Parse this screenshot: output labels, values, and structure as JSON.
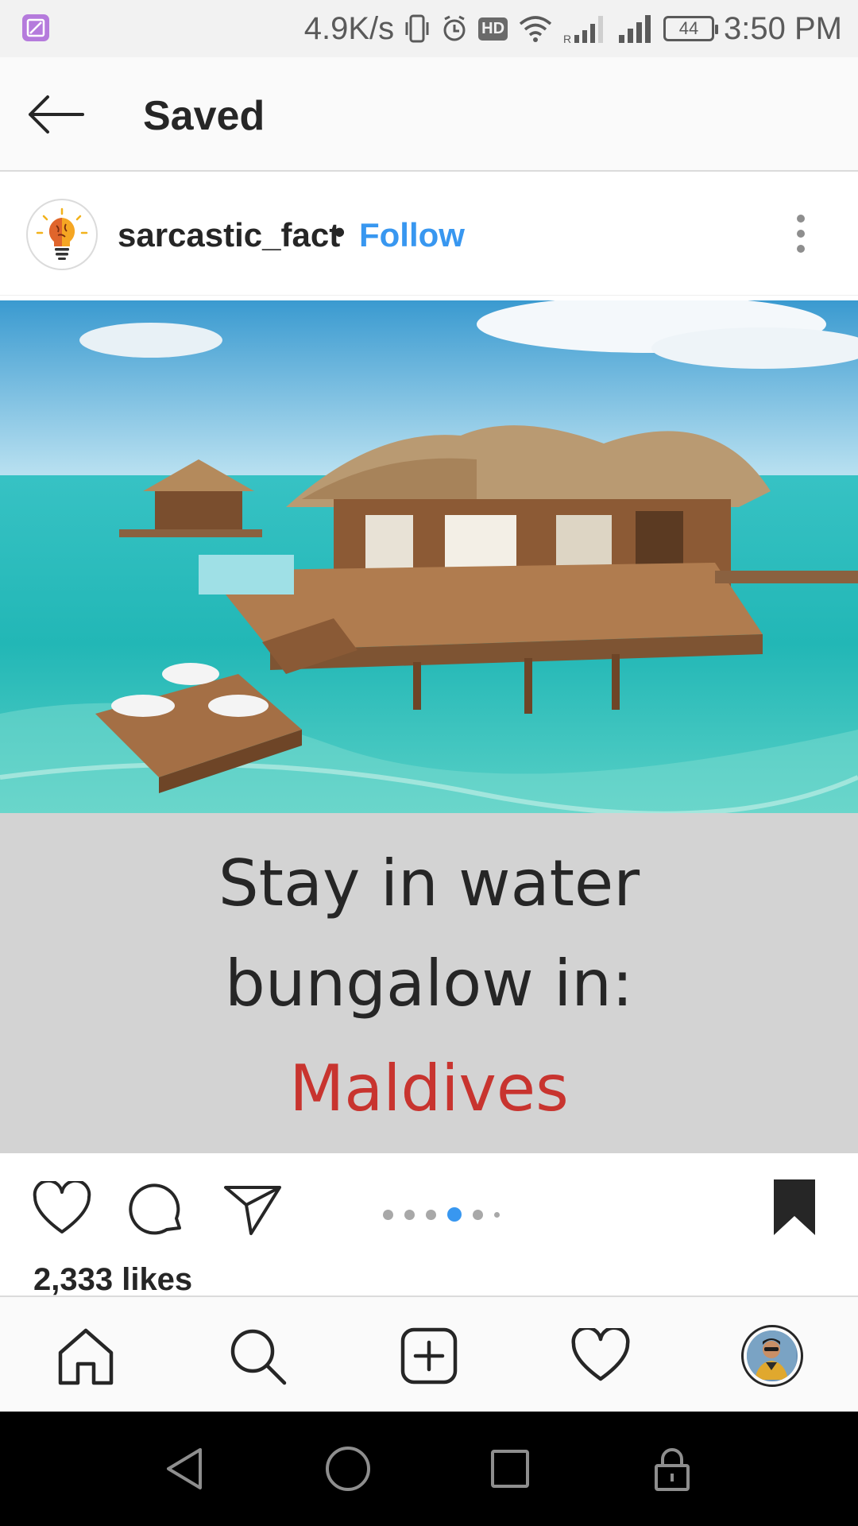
{
  "status_bar": {
    "network_speed": "4.9K/s",
    "hd_label": "HD",
    "battery_level": "44",
    "time": "3:50 PM",
    "icons": [
      "image-notification-icon",
      "vibrate-icon",
      "alarm-icon",
      "hd-icon",
      "wifi-icon",
      "signal-r-icon",
      "signal-icon",
      "battery-icon"
    ]
  },
  "top_bar": {
    "title": "Saved",
    "back_icon": "arrow-left-icon"
  },
  "post": {
    "username": "sarcastic_fact",
    "separator": "•",
    "follow_label": "Follow",
    "follow_color": "#3897f0",
    "avatar_icon": "lightbulb-brain-icon",
    "image_caption": {
      "line1": "Stay in water",
      "line2": "bungalow in:",
      "line3": "Maldives",
      "highlight_color": "#c8342f"
    },
    "carousel": {
      "total": 6,
      "active_index": 3
    },
    "likes": "2,333 likes",
    "saved": true
  },
  "bottom_nav": {
    "items": [
      "home-icon",
      "search-icon",
      "add-icon",
      "activity-heart-icon",
      "profile-avatar"
    ]
  },
  "system_nav": {
    "items": [
      "back-triangle-icon",
      "home-circle-icon",
      "recents-square-icon",
      "lock-icon"
    ]
  }
}
